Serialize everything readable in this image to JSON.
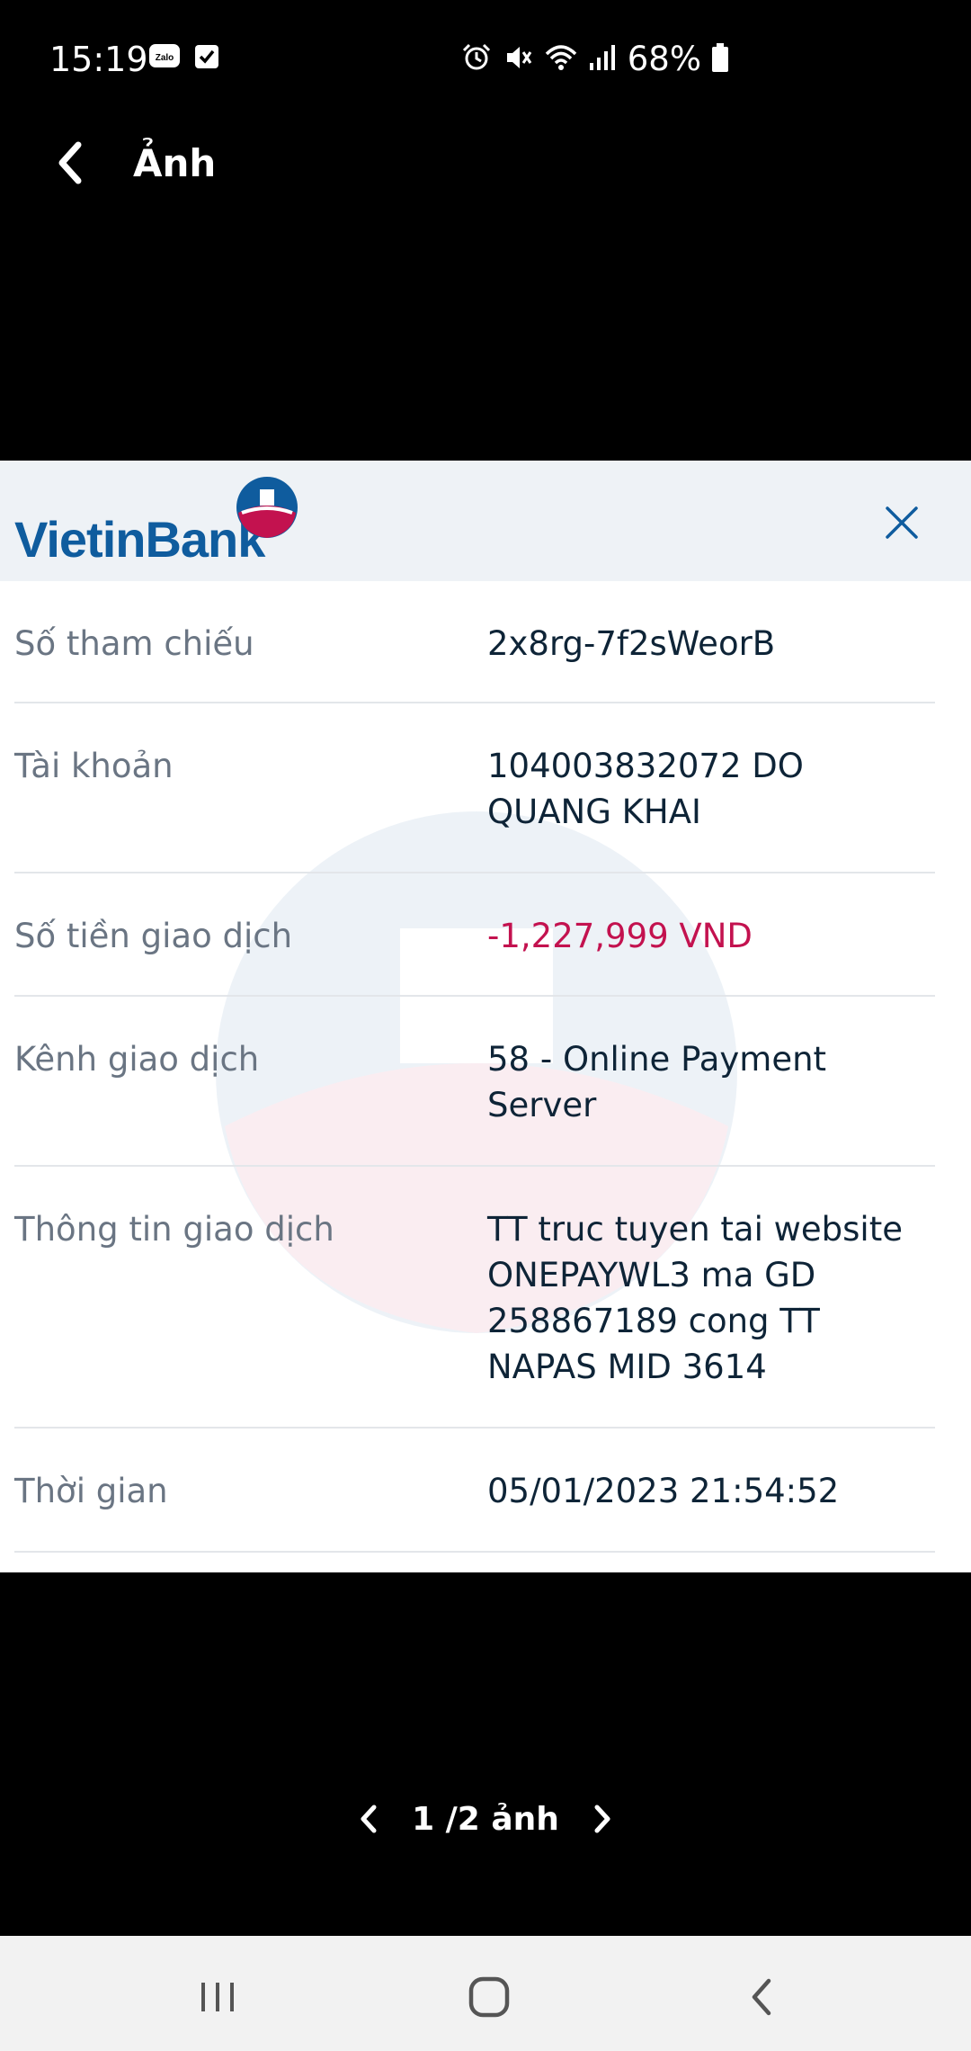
{
  "status_bar": {
    "time": "15:19",
    "battery": "68%",
    "left_icons": [
      "zalo-icon",
      "checkbox-icon"
    ],
    "right_icons": [
      "alarm-icon",
      "mute-icon",
      "wifi-icon",
      "signal-icon",
      "battery-icon"
    ]
  },
  "header": {
    "title": "Ảnh"
  },
  "receipt": {
    "brand": "VietinBank",
    "rows": [
      {
        "label": "Số tham chiếu",
        "value": "2x8rg-7f2sWeorB"
      },
      {
        "label": "Tài khoản",
        "value": "104003832072 DO QUANG KHAI"
      },
      {
        "label": "Số tiền giao dịch",
        "value": "-1,227,999 VND"
      },
      {
        "label": "Kênh giao dịch",
        "value": "58 - Online Payment Server"
      },
      {
        "label": "Thông tin giao dịch",
        "value": "TT truc tuyen tai website ONEPAYWL3 ma GD 258867189 cong TT NAPAS MID 3614"
      },
      {
        "label": "Thời gian",
        "value": "05/01/2023 21:54:52"
      }
    ]
  },
  "pager": {
    "label": "1 /2 ảnh"
  },
  "colors": {
    "brand_blue": "#0f5c9e",
    "brand_red": "#c3124f",
    "negative_amount": "#c3124f"
  }
}
